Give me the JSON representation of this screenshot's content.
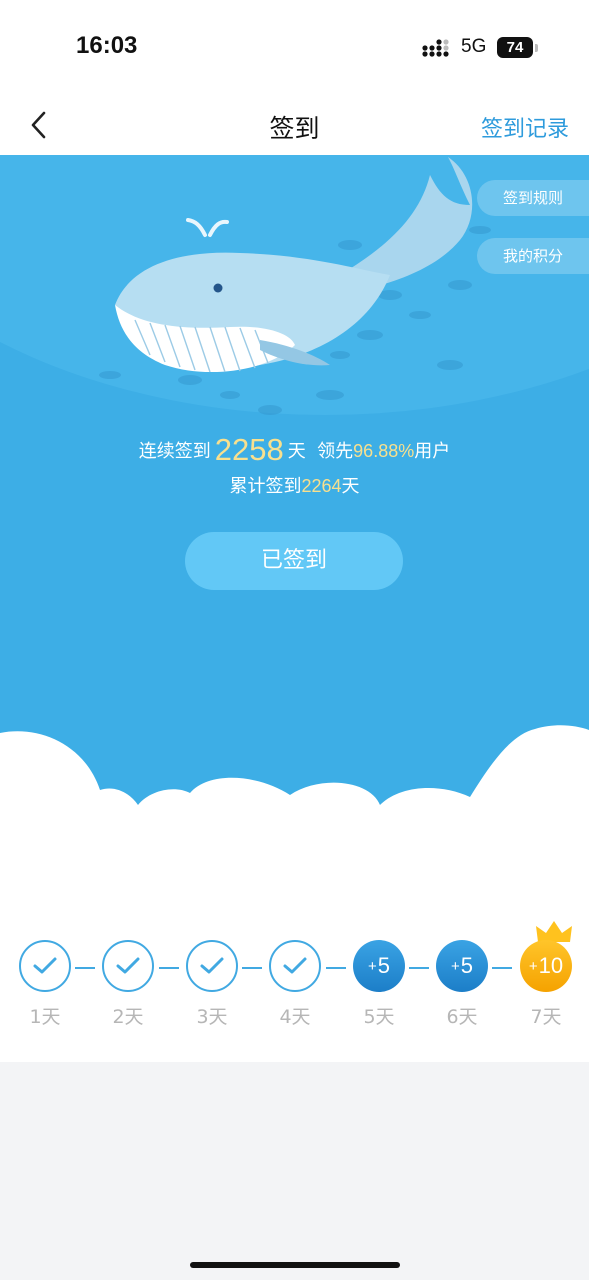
{
  "status_bar": {
    "time": "16:03",
    "network": "5G",
    "battery": "74"
  },
  "nav": {
    "title": "签到",
    "right_link": "签到记录"
  },
  "side_buttons": {
    "rules": "签到规则",
    "points": "我的积分"
  },
  "stats": {
    "streak_prefix": "连续签到",
    "streak_days": "2258",
    "streak_unit": "天",
    "lead_prefix": "领先",
    "lead_percent": "96.88%",
    "lead_suffix": "用户",
    "total_prefix": "累计签到",
    "total_days": "2264",
    "total_unit": "天"
  },
  "sign_button": "已签到",
  "days": [
    {
      "label": "1天",
      "state": "done"
    },
    {
      "label": "2天",
      "state": "done"
    },
    {
      "label": "3天",
      "state": "done"
    },
    {
      "label": "4天",
      "state": "done"
    },
    {
      "label": "5天",
      "state": "reward",
      "plus": "+",
      "reward": "5"
    },
    {
      "label": "6天",
      "state": "reward",
      "plus": "+",
      "reward": "5"
    },
    {
      "label": "7天",
      "state": "bonus",
      "plus": "+",
      "reward": "10"
    }
  ],
  "colors": {
    "hero": "#3daee6",
    "accent": "#2e9bdc",
    "gold": "#f8e08e",
    "bonus": "#f5a200"
  }
}
